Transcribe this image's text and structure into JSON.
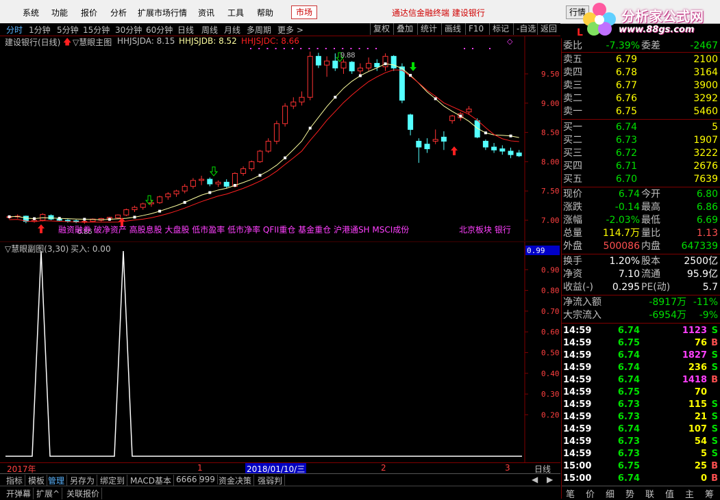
{
  "menu": [
    "系统",
    "功能",
    "报价",
    "分析",
    "扩展市场行情",
    "资讯",
    "工具",
    "帮助"
  ],
  "market_tab": "市场",
  "ad_text": "通达信金融终端  建设银行",
  "quote_tab": "行情",
  "logo": {
    "brand": "分析家公式网",
    "url": "www.88gs.com"
  },
  "periods": [
    "分时",
    "1分钟",
    "5分钟",
    "15分钟",
    "30分钟",
    "60分钟",
    "日线",
    "周线",
    "月线",
    "多周期",
    "更多 >"
  ],
  "tools": [
    "复权",
    "叠加",
    "统计",
    "画线",
    "F10",
    "标记",
    "-自选",
    "返回"
  ],
  "main": {
    "title": "建设银行(日线)",
    "indicator": "▽慧眼主图",
    "hhjsjda": "HHJSJDA: 8.15",
    "hhjsjdb": "HHJSJDB: 8.52",
    "hhjsjdc": "HHJSJDC: 8.66",
    "peak_label": "9.88",
    "low_label": "6.86",
    "tags": "融资融券 破净资产 高股息股 大盘股 低市盈率 低市净率 QFII重仓 基金重仓 沪港通SH MSCI成份",
    "tags2": "北京板块 银行",
    "yticks": [
      "9.50",
      "9.00",
      "8.50",
      "8.00",
      "7.50",
      "7.00"
    ]
  },
  "sub": {
    "title": "▽慧眼副图(3,30)",
    "buy": "买入: 0.00",
    "current": "0.99",
    "yticks": [
      "0.90",
      "0.80",
      "0.70",
      "0.60",
      "0.50",
      "0.40",
      "0.30",
      "0.20"
    ]
  },
  "xaxis": {
    "year": "2017年",
    "m1": "1",
    "date": "2018/01/10/三",
    "m2": "2",
    "m3": "3",
    "period": "日线"
  },
  "bottom_tabs": [
    "指标",
    "模板",
    "管理",
    "另存为",
    "绑定到",
    "MACD基本",
    "6666",
    "999",
    "资金决策",
    "强弱判"
  ],
  "bottom2": [
    "开弹幕",
    "扩展^",
    "关联报价"
  ],
  "quote": {
    "code_letter": "L",
    "weibi": {
      "label": "委比",
      "value": "-7.39%",
      "label2": "委差",
      "value2": "-2467"
    },
    "asks": [
      {
        "label": "卖五",
        "price": "6.79",
        "vol": "2100"
      },
      {
        "label": "卖四",
        "price": "6.78",
        "vol": "3164"
      },
      {
        "label": "卖三",
        "price": "6.77",
        "vol": "3900"
      },
      {
        "label": "卖二",
        "price": "6.76",
        "vol": "3292"
      },
      {
        "label": "卖一",
        "price": "6.75",
        "vol": "5460"
      }
    ],
    "bids": [
      {
        "label": "买一",
        "price": "6.74",
        "vol": "5"
      },
      {
        "label": "买二",
        "price": "6.73",
        "vol": "1907"
      },
      {
        "label": "买三",
        "price": "6.72",
        "vol": "3222"
      },
      {
        "label": "买四",
        "price": "6.71",
        "vol": "2676"
      },
      {
        "label": "买五",
        "price": "6.70",
        "vol": "7639"
      }
    ],
    "stats": [
      {
        "l1": "现价",
        "v1": "6.74",
        "c1": "green",
        "l2": "今开",
        "v2": "6.80",
        "c2": "green"
      },
      {
        "l1": "涨跌",
        "v1": "-0.14",
        "c1": "green",
        "l2": "最高",
        "v2": "6.86",
        "c2": "green"
      },
      {
        "l1": "涨幅",
        "v1": "-2.03%",
        "c1": "green",
        "l2": "最低",
        "v2": "6.69",
        "c2": "green"
      },
      {
        "l1": "总量",
        "v1": "114.7万",
        "c1": "yellow",
        "l2": "量比",
        "v2": "1.13",
        "c2": "red"
      },
      {
        "l1": "外盘",
        "v1": "500086",
        "c1": "red",
        "l2": "内盘",
        "v2": "647339",
        "c2": "green"
      }
    ],
    "stats2": [
      {
        "l1": "换手",
        "v1": "1.20%",
        "l2": "股本",
        "v2": "2500亿"
      },
      {
        "l1": "净资",
        "v1": "7.10",
        "l2": "流通",
        "v2": "95.9亿"
      },
      {
        "l1": "收益(-)",
        "v1": "0.295",
        "l2": "PE(动)",
        "v2": "5.7"
      }
    ],
    "flows": [
      {
        "label": "净流入额",
        "value": "-8917万",
        "pct": "-11%"
      },
      {
        "label": "大宗流入",
        "value": "-6954万",
        "pct": "-9%"
      }
    ],
    "ticks": [
      {
        "t": "14:59",
        "p": "6.74",
        "pc": "green",
        "v": "1123",
        "vc": "mag",
        "s": "S"
      },
      {
        "t": "14:59",
        "p": "6.75",
        "pc": "green",
        "v": "76",
        "vc": "yellow",
        "s": "B"
      },
      {
        "t": "14:59",
        "p": "6.74",
        "pc": "green",
        "v": "1827",
        "vc": "mag",
        "s": "S"
      },
      {
        "t": "14:59",
        "p": "6.74",
        "pc": "green",
        "v": "236",
        "vc": "yellow",
        "s": "S"
      },
      {
        "t": "14:59",
        "p": "6.74",
        "pc": "green",
        "v": "1418",
        "vc": "mag",
        "s": "B"
      },
      {
        "t": "14:59",
        "p": "6.75",
        "pc": "green",
        "v": "70",
        "vc": "yellow",
        "s": ""
      },
      {
        "t": "14:59",
        "p": "6.73",
        "pc": "green",
        "v": "115",
        "vc": "yellow",
        "s": "S"
      },
      {
        "t": "14:59",
        "p": "6.73",
        "pc": "green",
        "v": "21",
        "vc": "yellow",
        "s": "S"
      },
      {
        "t": "14:59",
        "p": "6.74",
        "pc": "green",
        "v": "107",
        "vc": "yellow",
        "s": "S"
      },
      {
        "t": "14:59",
        "p": "6.73",
        "pc": "green",
        "v": "54",
        "vc": "yellow",
        "s": "S"
      },
      {
        "t": "14:59",
        "p": "6.73",
        "pc": "green",
        "v": "5",
        "vc": "yellow",
        "s": "S"
      },
      {
        "t": "15:00",
        "p": "6.75",
        "pc": "green",
        "v": "25",
        "vc": "yellow",
        "s": "B"
      },
      {
        "t": "15:00",
        "p": "6.74",
        "pc": "green",
        "v": "0",
        "vc": "yellow",
        "s": "B"
      }
    ],
    "tabs": [
      "笔",
      "价",
      "细",
      "势",
      "联",
      "值",
      "主",
      "筹"
    ]
  },
  "colors": {
    "up": "#ff3232",
    "down": "#54ffff",
    "ma1": "#ffffa0",
    "ma2": "#ff2020",
    "border": "#800000"
  }
}
